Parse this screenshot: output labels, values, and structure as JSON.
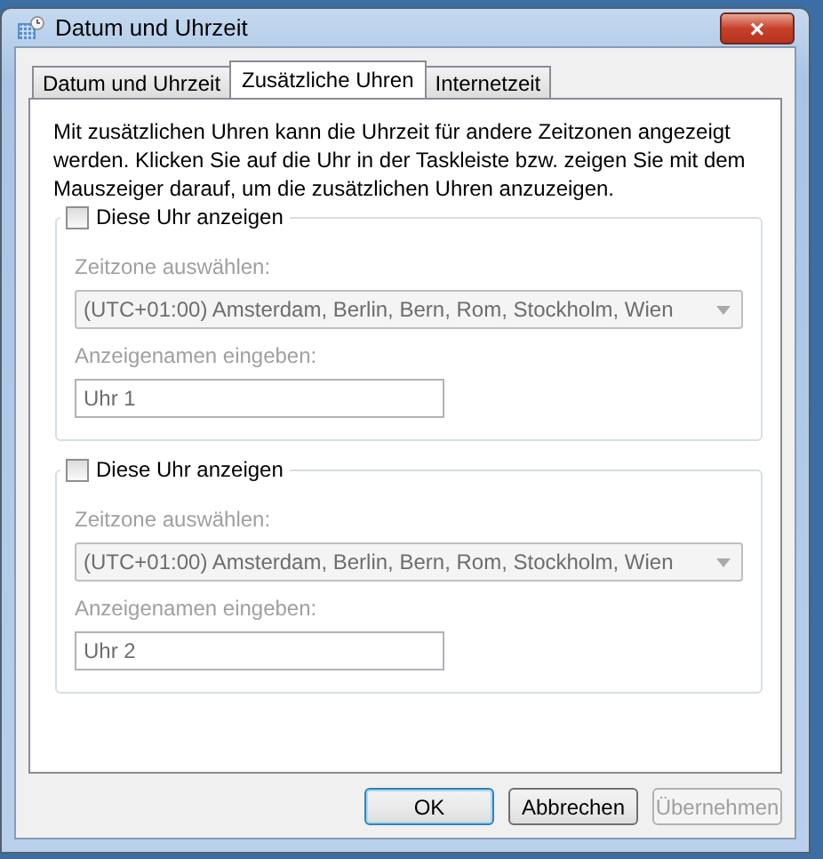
{
  "window": {
    "title": "Datum und Uhrzeit",
    "close": "×"
  },
  "tabs": [
    {
      "label": "Datum und Uhrzeit",
      "selected": false
    },
    {
      "label": "Zusätzliche Uhren",
      "selected": true
    },
    {
      "label": "Internetzeit",
      "selected": false
    }
  ],
  "description": "Mit zusätzlichen Uhren kann die Uhrzeit für andere Zeitzonen angezeigt werden. Klicken Sie auf die Uhr in der Taskleiste bzw. zeigen Sie mit dem Mauszeiger darauf, um die zusätzlichen Uhren anzuzeigen.",
  "clocks": [
    {
      "show_label": "Diese Uhr anzeigen",
      "checked": false,
      "timezone_label": "Zeitzone auswählen:",
      "timezone": "(UTC+01:00) Amsterdam, Berlin, Bern, Rom, Stockholm, Wien",
      "name_label": "Anzeigenamen eingeben:",
      "name": "Uhr 1"
    },
    {
      "show_label": "Diese Uhr anzeigen",
      "checked": false,
      "timezone_label": "Zeitzone auswählen:",
      "timezone": "(UTC+01:00) Amsterdam, Berlin, Bern, Rom, Stockholm, Wien",
      "name_label": "Anzeigenamen eingeben:",
      "name": "Uhr 2"
    }
  ],
  "buttons": [
    {
      "label": "OK",
      "kind": "default",
      "disabled": false
    },
    {
      "label": "Abbrechen",
      "kind": "normal",
      "disabled": false
    },
    {
      "label": "Übernehmen",
      "kind": "normal",
      "disabled": true
    }
  ]
}
